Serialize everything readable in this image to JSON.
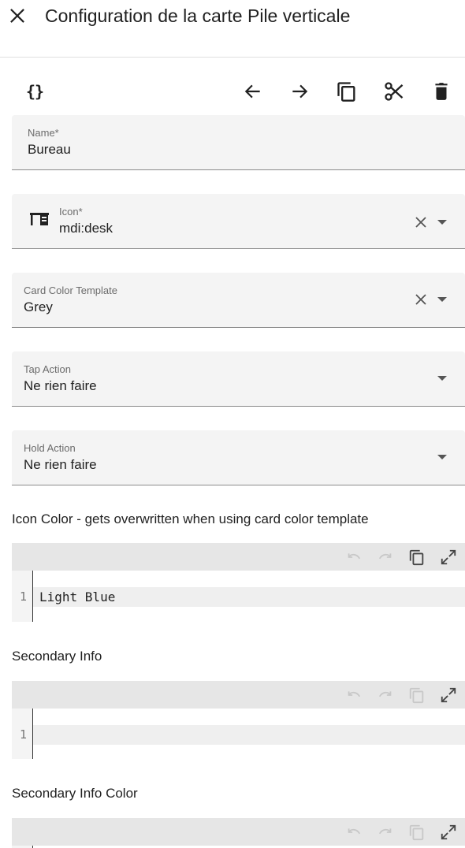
{
  "dialog": {
    "title": "Configuration de la carte Pile verticale"
  },
  "toolbar": {
    "code_editor_label": "{}",
    "icons": [
      "code-braces-icon",
      "arrow-left-icon",
      "arrow-right-icon",
      "copy-icon",
      "cut-icon",
      "delete-icon"
    ]
  },
  "form": {
    "name": {
      "label": "Name*",
      "value": "Bureau"
    },
    "icon": {
      "label": "Icon*",
      "value": "mdi:desk",
      "glyph": "desk-icon"
    },
    "card_color_template": {
      "label": "Card Color Template",
      "value": "Grey"
    },
    "tap_action": {
      "label": "Tap Action",
      "value": "Ne rien faire"
    },
    "hold_action": {
      "label": "Hold Action",
      "value": "Ne rien faire"
    }
  },
  "editors": [
    {
      "label": "Icon Color - gets overwritten when using card color template",
      "line_number": "1",
      "code": "Light Blue"
    },
    {
      "label": "Secondary Info",
      "line_number": "1",
      "code": ""
    },
    {
      "label": "Secondary Info Color",
      "line_number": "",
      "code": ""
    }
  ],
  "colors": {
    "field_background": "#f4f4f4",
    "editor_toolbar": "#e6e6e6",
    "text_primary": "#212121",
    "text_secondary": "#6b6b6b"
  }
}
